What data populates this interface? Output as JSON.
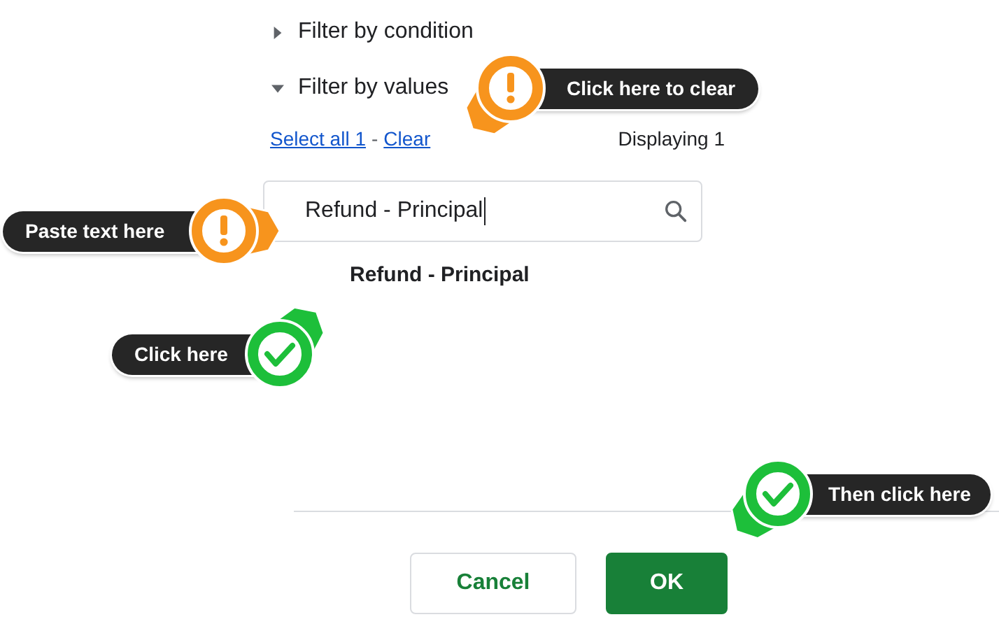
{
  "sections": [
    {
      "label": "Filter by condition",
      "expanded": false
    },
    {
      "label": "Filter by values",
      "expanded": true
    }
  ],
  "links": {
    "select_all": "Select all 1",
    "separator": "-",
    "clear": "Clear"
  },
  "displaying": "Displaying 1",
  "search": {
    "value": "Refund - Principal"
  },
  "values": [
    {
      "label": "Refund - Principal"
    }
  ],
  "buttons": [
    {
      "label": "Cancel",
      "kind": "secondary"
    },
    {
      "label": "OK",
      "kind": "primary"
    }
  ],
  "callouts": [
    {
      "text": "Click here to clear",
      "kind": "warning"
    },
    {
      "text": "Paste text here",
      "kind": "warning"
    },
    {
      "text": "Click here",
      "kind": "check"
    },
    {
      "text": "Then click here",
      "kind": "check"
    }
  ]
}
